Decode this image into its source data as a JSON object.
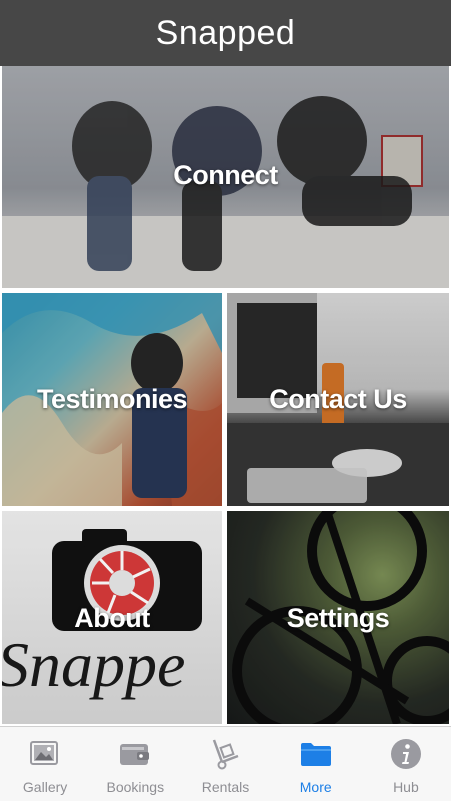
{
  "header": {
    "title": "Snapped"
  },
  "tiles": {
    "connect": "Connect",
    "testimonies": "Testimonies",
    "contact_us": "Contact Us",
    "about": "About",
    "settings": "Settings"
  },
  "tab_bar": {
    "active": "More",
    "items": [
      {
        "label": "Gallery",
        "icon": "gallery-icon"
      },
      {
        "label": "Bookings",
        "icon": "wallet-icon"
      },
      {
        "label": "Rentals",
        "icon": "hand-truck-icon"
      },
      {
        "label": "More",
        "icon": "folder-icon"
      },
      {
        "label": "Hub",
        "icon": "info-icon"
      }
    ]
  },
  "colors": {
    "active_tab": "#1d7fe6",
    "inactive_tab": "#8e8e93",
    "title_bar": "#373737"
  },
  "about_logo_text": "Snappe"
}
